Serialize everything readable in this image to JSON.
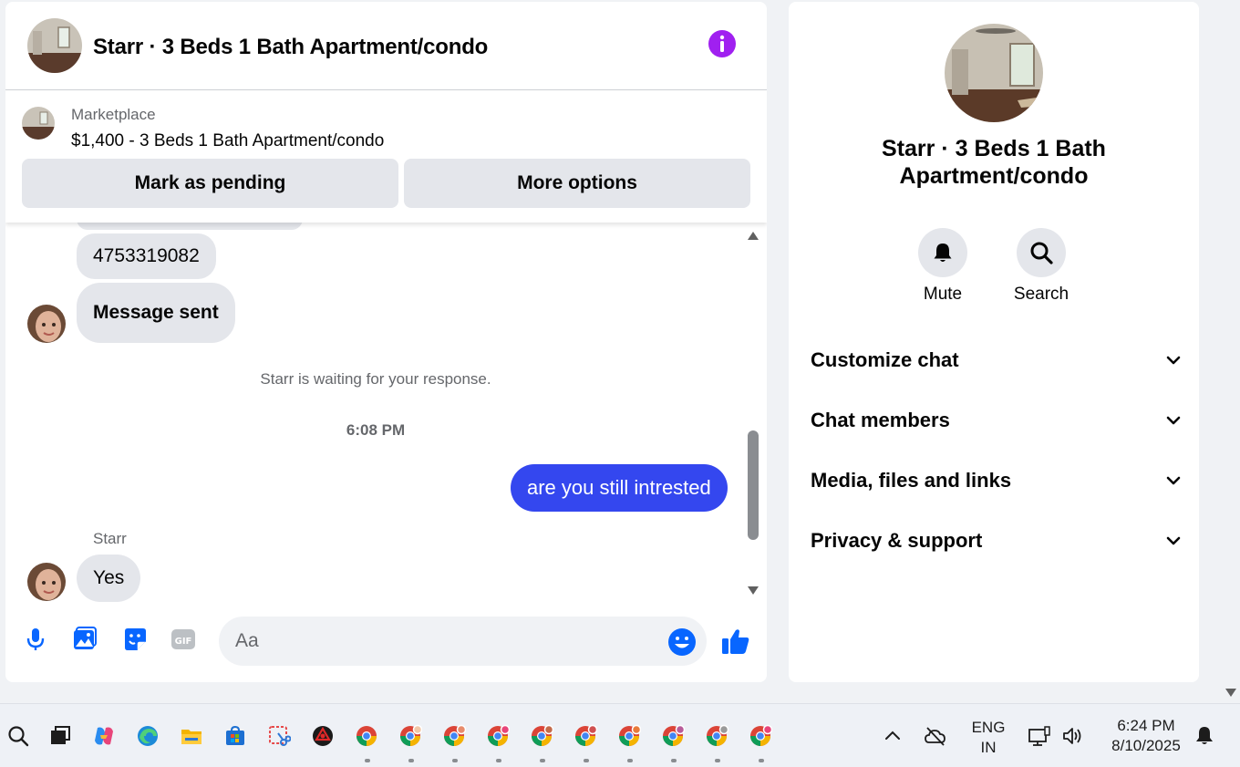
{
  "chat": {
    "title": "Starr · 3 Beds 1 Bath Apartment/condo",
    "marketplace_label": "Marketplace",
    "listing": "$1,400 - 3 Beds 1 Bath Apartment/condo",
    "mark_pending_label": "Mark as pending",
    "more_options_label": "More options",
    "messages": {
      "phone": "4753319082",
      "sent": "Message sent",
      "waiting": "Starr is waiting for your response.",
      "timestamp": "6:08 PM",
      "mine": "are you still intrested",
      "sender": "Starr",
      "reply": "Yes"
    },
    "composer_placeholder": "Aa"
  },
  "side": {
    "title": "Starr · 3 Beds 1 Bath Apartment/condo",
    "mute_label": "Mute",
    "search_label": "Search",
    "sections": [
      "Customize chat",
      "Chat members",
      "Media, files and links",
      "Privacy & support"
    ]
  },
  "taskbar": {
    "language": "ENG",
    "region": "IN",
    "time": "6:24 PM",
    "date": "8/10/2025"
  },
  "colors": {
    "accent": "#0866ff",
    "sent_bubble": "#3447ef",
    "info": "#a020f0"
  }
}
